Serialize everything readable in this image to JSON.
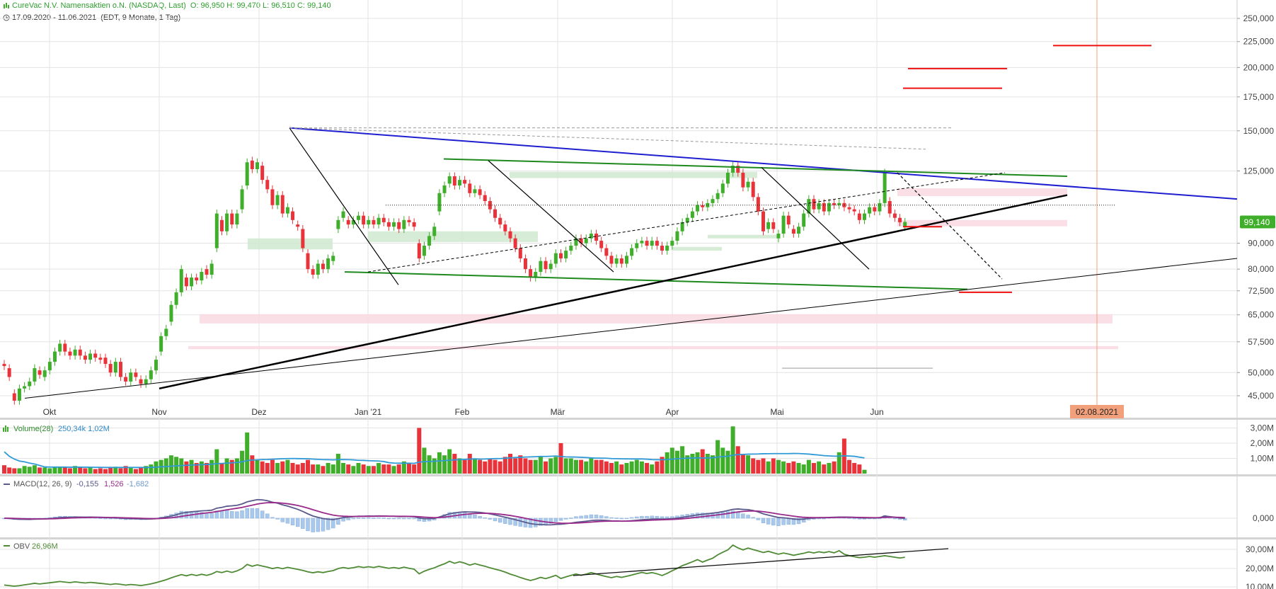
{
  "header": {
    "title": "CureVac N.V. Namensaktien   o.N. (NASDAQ, Last)",
    "ohlc": "O: 96,950   H: 99,470   L: 96,510   C: 99,140",
    "range": "17.09.2020 - 11.06.2021",
    "range_meta": "(EDT, 9 Monate, 1 Tag)"
  },
  "colors": {
    "up": "#3fae2a",
    "down": "#e8333a",
    "trend_blue": "#1f1fd0",
    "trend_green": "#1e8a1e",
    "trend_black": "#000000",
    "red_level": "#ee1111",
    "zone_pink": "#f9d9e3",
    "zone_green": "#cfe9cf",
    "volume_avg": "#2f9ad6",
    "macd": "#5a5a8c",
    "macd_signal": "#9a2a8a",
    "macd_hist": "#a8c8ec",
    "obv": "#4f8a34",
    "grid": "#e3e3e3",
    "last_price_bg": "#3fae2a",
    "date_marker_bg": "#f2a07b"
  },
  "chart_data": [
    {
      "type": "candlestick",
      "title": "CureVac N.V. Namensaktien   o.N. (NASDAQ, Last)",
      "y_ticks": [
        "250,000",
        "225,000",
        "200,000",
        "175,000",
        "150,000",
        "125,000",
        "99,140",
        "90,000",
        "80,000",
        "72,500",
        "65,000",
        "57,500",
        "50,000",
        "45,000"
      ],
      "y_tick_values": [
        250,
        225,
        200,
        175,
        150,
        125,
        90,
        80,
        72.5,
        65,
        57.5,
        50,
        45
      ],
      "y_scale": "log",
      "ylim": [
        41,
        270
      ],
      "x_labels": [
        "Okt",
        "Nov",
        "Dez",
        "Jan '21",
        "Feb",
        "Mär",
        "Apr",
        "Mai",
        "Jun"
      ],
      "last_price": 99.14,
      "last_price_label": "99,140",
      "date_marker": "02.08.2021",
      "candles": [
        {
          "o": 52.0,
          "c": 51.5
        },
        {
          "o": 51.0,
          "c": 49.0
        },
        {
          "o": 45.5,
          "c": 44.0
        },
        {
          "o": 44.0,
          "c": 46.5
        },
        {
          "o": 46.5,
          "c": 47.0
        },
        {
          "o": 47.0,
          "c": 48.0
        },
        {
          "o": 48.0,
          "c": 51.0
        },
        {
          "o": 50.5,
          "c": 49.5
        },
        {
          "o": 49.0,
          "c": 50.5
        },
        {
          "o": 50.5,
          "c": 52.5
        },
        {
          "o": 52.5,
          "c": 55.0
        },
        {
          "o": 55.0,
          "c": 57.0
        },
        {
          "o": 57.0,
          "c": 55.0
        },
        {
          "o": 55.0,
          "c": 54.0
        },
        {
          "o": 54.0,
          "c": 55.5
        },
        {
          "o": 55.5,
          "c": 54.0
        },
        {
          "o": 54.0,
          "c": 53.0
        },
        {
          "o": 53.0,
          "c": 54.5
        },
        {
          "o": 54.5,
          "c": 53.5
        },
        {
          "o": 53.5,
          "c": 53.0
        },
        {
          "o": 53.5,
          "c": 52.0
        },
        {
          "o": 52.0,
          "c": 50.0
        },
        {
          "o": 50.0,
          "c": 52.5
        },
        {
          "o": 52.5,
          "c": 49.0
        },
        {
          "o": 49.0,
          "c": 48.0
        },
        {
          "o": 48.0,
          "c": 50.0
        },
        {
          "o": 50.0,
          "c": 49.0
        },
        {
          "o": 48.5,
          "c": 47.5
        },
        {
          "o": 47.5,
          "c": 48.5
        },
        {
          "o": 48.5,
          "c": 50.5
        },
        {
          "o": 50.5,
          "c": 53.0
        },
        {
          "o": 55.0,
          "c": 59.0
        },
        {
          "o": 59.0,
          "c": 61.0
        },
        {
          "o": 63.0,
          "c": 68.0
        },
        {
          "o": 68.0,
          "c": 72.0
        },
        {
          "o": 72.0,
          "c": 80.0
        },
        {
          "o": 77.0,
          "c": 74.0
        },
        {
          "o": 74.0,
          "c": 77.0
        },
        {
          "o": 77.0,
          "c": 76.0
        },
        {
          "o": 76.0,
          "c": 79.0
        },
        {
          "o": 80.0,
          "c": 78.0
        },
        {
          "o": 78.0,
          "c": 82.0
        },
        {
          "o": 88.0,
          "c": 103.0
        },
        {
          "o": 100.0,
          "c": 95.0
        },
        {
          "o": 95.0,
          "c": 103.0
        },
        {
          "o": 103.0,
          "c": 98.0
        },
        {
          "o": 98.0,
          "c": 103.0
        },
        {
          "o": 105.0,
          "c": 115.0
        },
        {
          "o": 117.0,
          "c": 130.0
        },
        {
          "o": 131.0,
          "c": 126.0
        },
        {
          "o": 126.0,
          "c": 130.0
        },
        {
          "o": 128.0,
          "c": 120.0
        },
        {
          "o": 120.0,
          "c": 115.0
        },
        {
          "o": 115.0,
          "c": 107.0
        },
        {
          "o": 107.0,
          "c": 112.0
        },
        {
          "o": 112.0,
          "c": 103.0
        },
        {
          "o": 103.0,
          "c": 106.0
        },
        {
          "o": 104.0,
          "c": 100.0
        },
        {
          "o": 98.0,
          "c": 97.0
        },
        {
          "o": 96.0,
          "c": 88.0
        },
        {
          "o": 86.0,
          "c": 80.0
        },
        {
          "o": 80.0,
          "c": 78.0
        },
        {
          "o": 78.0,
          "c": 82.0
        },
        {
          "o": 82.0,
          "c": 80.0
        },
        {
          "o": 80.0,
          "c": 84.0
        },
        {
          "o": 83.0,
          "c": 85.0
        },
        {
          "o": 96.0,
          "c": 100.0
        },
        {
          "o": 101.0,
          "c": 104.0
        },
        {
          "o": 100.0,
          "c": 98.0
        },
        {
          "o": 98.0,
          "c": 100.0
        },
        {
          "o": 100.0,
          "c": 102.0
        },
        {
          "o": 102.0,
          "c": 98.0
        },
        {
          "o": 98.0,
          "c": 100.0
        },
        {
          "o": 100.0,
          "c": 98.0
        },
        {
          "o": 98.0,
          "c": 101.0
        },
        {
          "o": 101.0,
          "c": 99.0
        },
        {
          "o": 99.0,
          "c": 97.0
        },
        {
          "o": 97.0,
          "c": 99.0
        },
        {
          "o": 99.0,
          "c": 96.0
        },
        {
          "o": 96.0,
          "c": 100.0
        },
        {
          "o": 100.0,
          "c": 99.0
        },
        {
          "o": 99.0,
          "c": 97.0
        },
        {
          "o": 90.0,
          "c": 84.0
        },
        {
          "o": 85.0,
          "c": 89.0
        },
        {
          "o": 89.0,
          "c": 93.0
        },
        {
          "o": 93.0,
          "c": 97.0
        },
        {
          "o": 104.0,
          "c": 113.0
        },
        {
          "o": 113.0,
          "c": 117.0
        },
        {
          "o": 118.0,
          "c": 122.0
        },
        {
          "o": 122.0,
          "c": 117.0
        },
        {
          "o": 117.0,
          "c": 120.0
        },
        {
          "o": 120.0,
          "c": 118.0
        },
        {
          "o": 118.0,
          "c": 113.0
        },
        {
          "o": 113.0,
          "c": 115.0
        },
        {
          "o": 115.0,
          "c": 112.0
        },
        {
          "o": 112.0,
          "c": 109.0
        },
        {
          "o": 109.0,
          "c": 105.0
        },
        {
          "o": 105.0,
          "c": 101.0
        },
        {
          "o": 101.0,
          "c": 98.0
        },
        {
          "o": 98.0,
          "c": 95.0
        },
        {
          "o": 95.0,
          "c": 92.0
        },
        {
          "o": 92.0,
          "c": 88.0
        },
        {
          "o": 88.0,
          "c": 84.0
        },
        {
          "o": 84.0,
          "c": 80.0
        },
        {
          "o": 80.0,
          "c": 77.0
        },
        {
          "o": 77.0,
          "c": 79.0
        },
        {
          "o": 79.0,
          "c": 83.0
        },
        {
          "o": 83.0,
          "c": 80.0
        },
        {
          "o": 80.0,
          "c": 82.0
        },
        {
          "o": 82.0,
          "c": 86.0
        },
        {
          "o": 86.0,
          "c": 84.0
        },
        {
          "o": 84.0,
          "c": 87.0
        },
        {
          "o": 87.0,
          "c": 89.0
        },
        {
          "o": 89.0,
          "c": 92.0
        },
        {
          "o": 92.0,
          "c": 90.0
        },
        {
          "o": 90.0,
          "c": 92.0
        },
        {
          "o": 92.0,
          "c": 94.0
        },
        {
          "o": 94.0,
          "c": 91.0
        },
        {
          "o": 91.0,
          "c": 88.0
        },
        {
          "o": 88.0,
          "c": 85.0
        },
        {
          "o": 85.0,
          "c": 82.0
        },
        {
          "o": 82.0,
          "c": 84.0
        },
        {
          "o": 84.0,
          "c": 82.0
        },
        {
          "o": 82.0,
          "c": 85.0
        },
        {
          "o": 85.0,
          "c": 88.0
        },
        {
          "o": 88.0,
          "c": 90.0
        },
        {
          "o": 90.0,
          "c": 91.0
        },
        {
          "o": 91.0,
          "c": 89.0
        },
        {
          "o": 89.0,
          "c": 91.0
        },
        {
          "o": 91.0,
          "c": 89.0
        },
        {
          "o": 89.0,
          "c": 87.0
        },
        {
          "o": 87.0,
          "c": 89.0
        },
        {
          "o": 89.0,
          "c": 91.0
        },
        {
          "o": 91.0,
          "c": 95.0
        },
        {
          "o": 95.0,
          "c": 99.0
        },
        {
          "o": 99.0,
          "c": 101.0
        },
        {
          "o": 101.0,
          "c": 104.0
        },
        {
          "o": 104.0,
          "c": 107.0
        },
        {
          "o": 107.0,
          "c": 106.0
        },
        {
          "o": 106.0,
          "c": 108.0
        },
        {
          "o": 108.0,
          "c": 110.0
        },
        {
          "o": 110.0,
          "c": 113.0
        },
        {
          "o": 113.0,
          "c": 118.0
        },
        {
          "o": 118.0,
          "c": 124.0
        },
        {
          "o": 124.0,
          "c": 128.0
        },
        {
          "o": 128.0,
          "c": 124.0
        },
        {
          "o": 124.0,
          "c": 116.0
        },
        {
          "o": 116.0,
          "c": 119.0
        },
        {
          "o": 119.0,
          "c": 111.0
        },
        {
          "o": 111.0,
          "c": 104.0
        },
        {
          "o": 104.0,
          "c": 95.0
        },
        {
          "o": 96.0,
          "c": 99.0
        },
        {
          "o": 99.0,
          "c": 96.0
        },
        {
          "o": 92.0,
          "c": 94.0
        },
        {
          "o": 94.0,
          "c": 102.0
        },
        {
          "o": 102.0,
          "c": 98.0
        },
        {
          "o": 96.0,
          "c": 94.0
        },
        {
          "o": 94.0,
          "c": 97.0
        },
        {
          "o": 97.0,
          "c": 103.0
        },
        {
          "o": 103.0,
          "c": 110.0
        },
        {
          "o": 110.0,
          "c": 105.0
        },
        {
          "o": 105.0,
          "c": 108.0
        },
        {
          "o": 108.0,
          "c": 104.0
        },
        {
          "o": 104.0,
          "c": 108.0
        },
        {
          "o": 108.0,
          "c": 107.0
        },
        {
          "o": 107.0,
          "c": 108.0
        },
        {
          "o": 108.0,
          "c": 106.0
        },
        {
          "o": 106.0,
          "c": 105.0
        },
        {
          "o": 105.0,
          "c": 104.0
        },
        {
          "o": 103.0,
          "c": 100.0
        },
        {
          "o": 100.0,
          "c": 103.0
        },
        {
          "o": 103.0,
          "c": 106.0
        },
        {
          "o": 106.0,
          "c": 104.0
        },
        {
          "o": 104.0,
          "c": 108.0
        },
        {
          "o": 108.0,
          "c": 124.0
        },
        {
          "o": 109.0,
          "c": 103.0
        },
        {
          "o": 103.0,
          "c": 101.0
        },
        {
          "o": 101.0,
          "c": 99.0
        },
        {
          "o": 96.95,
          "c": 99.14
        }
      ],
      "annotations": {
        "trendlines": [
          {
            "color": "trend_blue",
            "from": [
              44,
              152
            ],
            "to": [
              126,
              110
            ]
          },
          {
            "color": "trend_green",
            "from": [
              76,
              132
            ],
            "to": [
              188,
              122
            ]
          },
          {
            "color": "trend_green",
            "from": [
              58,
              79
            ],
            "to": [
              170,
              73
            ]
          },
          {
            "color": "trend_black",
            "from": [
              25,
              46.5
            ],
            "to": [
              188,
              112
            ]
          },
          {
            "color": "trend_black",
            "from": [
              4,
              44.5
            ],
            "to": [
              214,
              84
            ]
          }
        ],
        "red_levels": [
          221,
          199,
          182,
          97,
          72
        ]
      }
    },
    {
      "type": "bar",
      "title": "Volume(28)",
      "label_values": "250,34k   1,02M",
      "y_ticks": [
        "3,00M",
        "2,00M",
        "1,00M"
      ],
      "volume_millions": [
        0.55,
        0.4,
        0.35,
        0.35,
        0.5,
        0.45,
        0.55,
        0.4,
        0.4,
        0.35,
        0.4,
        0.45,
        0.4,
        0.35,
        0.5,
        0.4,
        0.35,
        0.4,
        0.3,
        0.35,
        0.3,
        0.4,
        0.45,
        0.35,
        0.5,
        0.4,
        0.3,
        0.4,
        0.5,
        0.6,
        0.8,
        0.9,
        1.0,
        1.2,
        1.1,
        1.0,
        0.8,
        0.9,
        0.7,
        0.8,
        0.7,
        0.9,
        1.6,
        0.7,
        1.0,
        0.9,
        1.0,
        1.5,
        2.7,
        1.2,
        0.9,
        0.8,
        0.7,
        0.9,
        0.7,
        0.8,
        0.9,
        0.7,
        0.6,
        0.7,
        0.9,
        0.6,
        0.6,
        0.5,
        0.7,
        0.6,
        1.3,
        0.7,
        0.6,
        0.5,
        0.7,
        0.6,
        0.5,
        0.5,
        0.7,
        0.6,
        0.6,
        0.5,
        0.6,
        0.8,
        0.7,
        0.6,
        3.0,
        1.7,
        1.2,
        1.0,
        1.4,
        1.2,
        1.6,
        1.3,
        1.0,
        0.9,
        1.3,
        1.0,
        0.9,
        0.8,
        1.0,
        0.9,
        0.8,
        1.1,
        1.3,
        1.0,
        1.2,
        1.0,
        0.9,
        0.9,
        1.1,
        0.8,
        1.0,
        1.1,
        2.0,
        1.0,
        1.0,
        0.9,
        0.9,
        0.8,
        1.0,
        0.9,
        0.9,
        0.8,
        0.7,
        0.8,
        0.6,
        0.7,
        0.8,
        0.9,
        0.8,
        0.7,
        0.6,
        0.8,
        1.1,
        1.4,
        1.7,
        1.5,
        1.8,
        1.2,
        1.3,
        1.4,
        1.6,
        1.3,
        1.2,
        2.2,
        1.7,
        1.5,
        3.1,
        1.8,
        1.3,
        1.2,
        1.0,
        0.9,
        1.0,
        0.8,
        1.0,
        0.9,
        0.8,
        0.7,
        0.8,
        0.7,
        0.6,
        0.9,
        0.7,
        0.8,
        0.6,
        0.7,
        0.8,
        1.4,
        2.3,
        0.9,
        0.7,
        0.6,
        0.25
      ]
    },
    {
      "type": "line",
      "title": "MACD(12, 26, 9)",
      "label_values": [
        "-0,155",
        "1,526",
        "-1,682"
      ],
      "y_ticks": [
        "0,000"
      ]
    },
    {
      "type": "line",
      "title": "OBV",
      "label_values": "26,96M",
      "y_ticks": [
        "30,00M",
        "20,00M",
        "10,00M"
      ]
    }
  ]
}
